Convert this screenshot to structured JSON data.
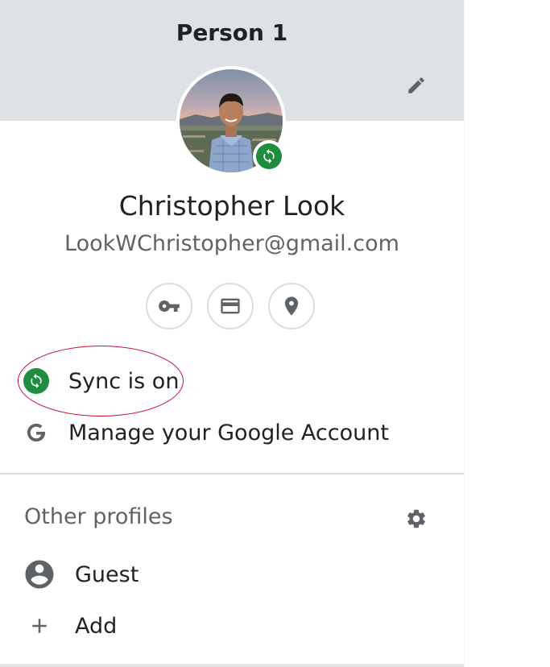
{
  "header": {
    "title": "Person 1",
    "edit_icon": "pencil-icon"
  },
  "user": {
    "name": "Christopher Look",
    "email": "LookWChristopher@gmail.com",
    "avatar": "profile-photo",
    "sync_badge_icon": "sync-icon"
  },
  "quick_actions": [
    {
      "icon": "key-icon",
      "purpose": "passwords"
    },
    {
      "icon": "credit-card-icon",
      "purpose": "payment methods"
    },
    {
      "icon": "location-pin-icon",
      "purpose": "addresses"
    }
  ],
  "menu": {
    "sync_label": "Sync is on",
    "manage_account_label": "Manage your Google Account"
  },
  "other_profiles": {
    "title": "Other profiles",
    "settings_icon": "gear-icon",
    "items": [
      {
        "label": "Guest",
        "icon": "account-circle-icon"
      },
      {
        "label": "Add",
        "icon": "plus-icon"
      }
    ]
  },
  "colors": {
    "header_bg": "#dee1e6",
    "sync_green": "#1e8e3e",
    "icon_gray": "#5f6368",
    "annotation_red": "#c8102e"
  }
}
